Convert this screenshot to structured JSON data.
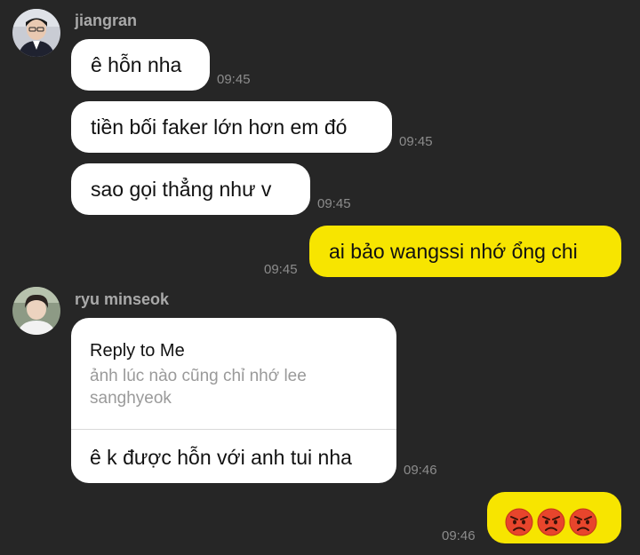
{
  "messages": [
    {
      "sender": "jiangran",
      "text": "ê hỗn nha",
      "time": "09:45"
    },
    {
      "text": "tiền bối faker lớn hơn em đó",
      "time": "09:45"
    },
    {
      "text": "sao gọi thẳng như v",
      "time": "09:45"
    },
    {
      "text": "ai bảo wangssi nhớ ổng chi",
      "time": "09:45",
      "outgoing": true
    },
    {
      "sender": "ryu minseok",
      "reply": {
        "label": "Reply to Me",
        "quote_line1": "ảnh lúc nào cũng chỉ nhớ lee",
        "quote_line2": "sanghyeok"
      },
      "text": "ê k được hỗn với anh tui nha",
      "time": "09:46"
    },
    {
      "emoji": "angry-face-emoji",
      "emoji_count": 3,
      "time": "09:46",
      "outgoing": true
    }
  ],
  "colors": {
    "background": "#262626",
    "incoming_bubble": "#ffffff",
    "outgoing_bubble": "#f7e500",
    "time_text": "#8c8c8c",
    "sender_text": "#a9a9a9",
    "emoji_face": "#e8452c"
  }
}
